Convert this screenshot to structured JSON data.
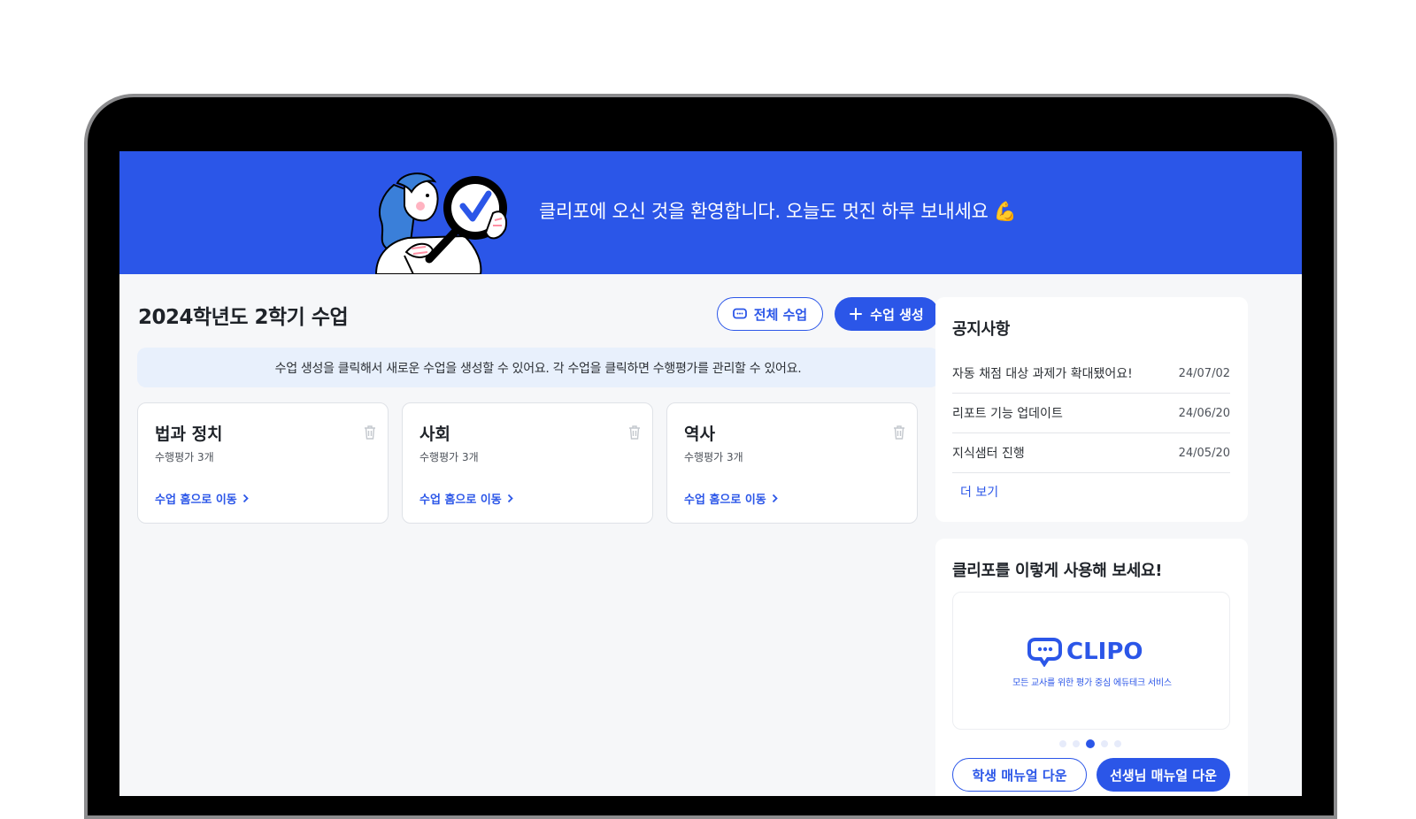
{
  "banner": {
    "welcome": "클리포에 오신 것을 환영합니다. 오늘도 멋진 하루 보내세요",
    "emoji": "💪"
  },
  "main": {
    "title": "2024학년도 2학기 수업",
    "all_classes_label": "전체 수업",
    "create_class_label": "수업 생성",
    "info": "수업 생성을 클릭해서 새로운 수업을 생성할 수 있어요. 각 수업을 클릭하면 수행평가를 관리할 수 있어요.",
    "cards": [
      {
        "title": "법과 정치",
        "subtitle": "수행평가 3개",
        "link": "수업 홈으로 이동"
      },
      {
        "title": "사회",
        "subtitle": "수행평가 3개",
        "link": "수업 홈으로 이동"
      },
      {
        "title": "역사",
        "subtitle": "수행평가 3개",
        "link": "수업 홈으로 이동"
      }
    ]
  },
  "notice": {
    "title": "공지사항",
    "items": [
      {
        "text": "자동 채점 대상 과제가 확대됐어요!",
        "date": "24/07/02"
      },
      {
        "text": "리포트 기능 업데이트",
        "date": "24/06/20"
      },
      {
        "text": "지식샘터 진행",
        "date": "24/05/20"
      }
    ],
    "more": "더 보기"
  },
  "promo": {
    "title": "클리포를 이렇게 사용해 보세요!",
    "logo_text": "CLIPO",
    "tagline": "모든 교사를 위한 평가 중심 에듀테크 서비스",
    "carousel_total": 5,
    "carousel_active": 3,
    "student_manual": "학생 매뉴얼 다운",
    "teacher_manual": "선생님 매뉴얼 다운"
  },
  "colors": {
    "brand": "#2b56e8",
    "info_bg": "#e8f0fc",
    "screen_bg": "#f6f7f9"
  },
  "icons": [
    "illustration-girl-magnifier",
    "chat-bubble-icon",
    "plus-icon",
    "trash-icon",
    "chevron-right-icon",
    "clipo-logo-icon"
  ]
}
